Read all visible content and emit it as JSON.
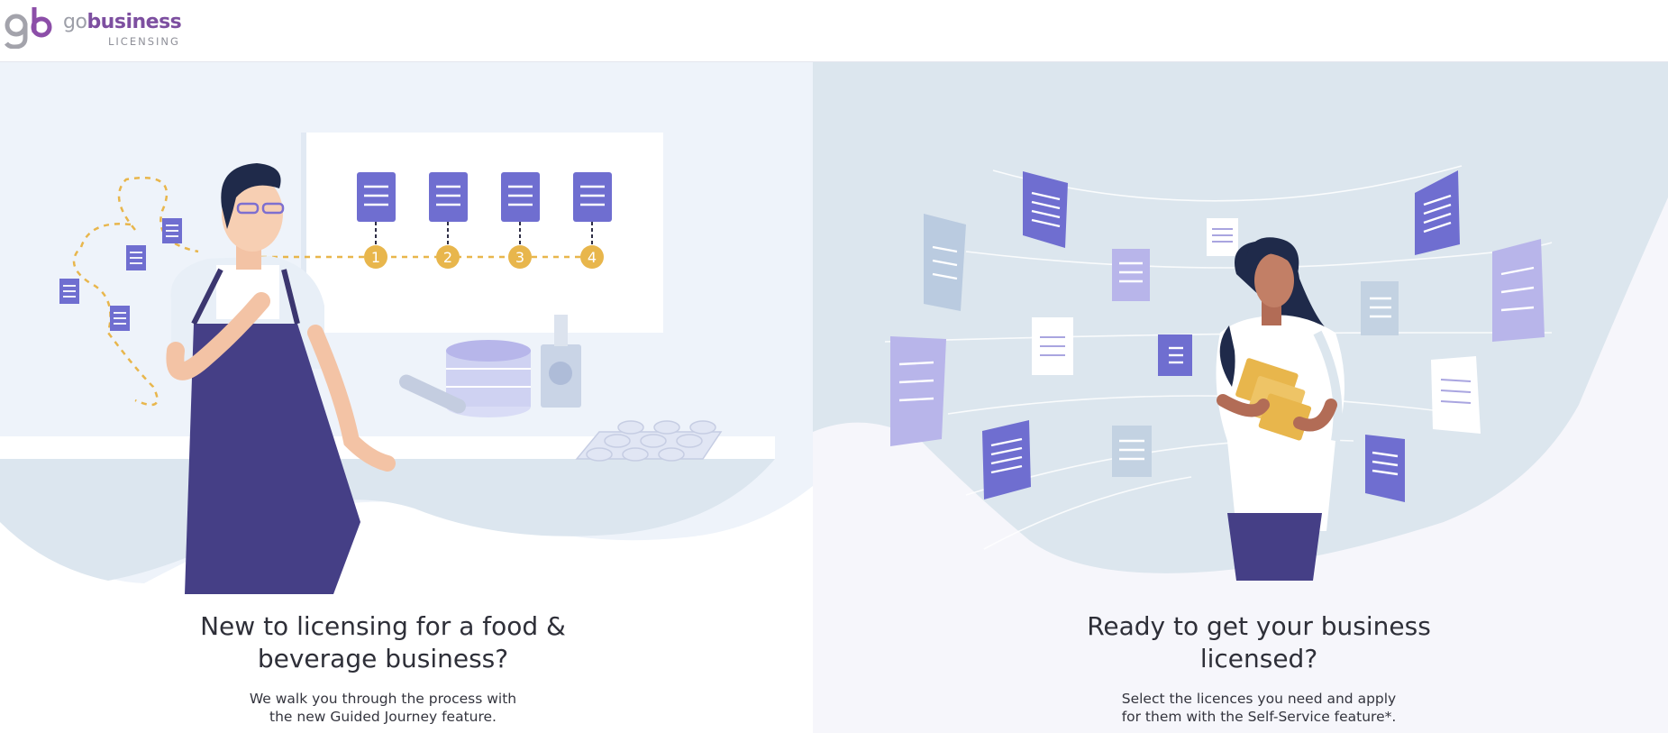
{
  "header": {
    "logo_go": "go",
    "logo_business": "business",
    "logo_sub": "LICENSING",
    "logo_icon": "gb-monogram-icon"
  },
  "panels": {
    "left": {
      "title_line1": "New to licensing for a food &",
      "title_line2": "beverage business?",
      "desc_line1": "We walk you through the process with",
      "desc_line2": "the new Guided Journey feature.",
      "steps": [
        "1",
        "2",
        "3",
        "4"
      ],
      "illustration": "chef-guided-journey-illustration"
    },
    "right": {
      "title_line1": "Ready to get your business",
      "title_line2": "licensed?",
      "desc_line1": "Select the licences you need and apply",
      "desc_line2": "for them with the Self-Service feature*.",
      "illustration": "woman-floating-documents-illustration"
    }
  },
  "colors": {
    "brand_purple": "#7d4fa0",
    "doc_purple": "#6f6ed0",
    "step_gold": "#e8b64c",
    "apron_navy": "#453f86",
    "panel_blue": "#dfe7ef"
  }
}
